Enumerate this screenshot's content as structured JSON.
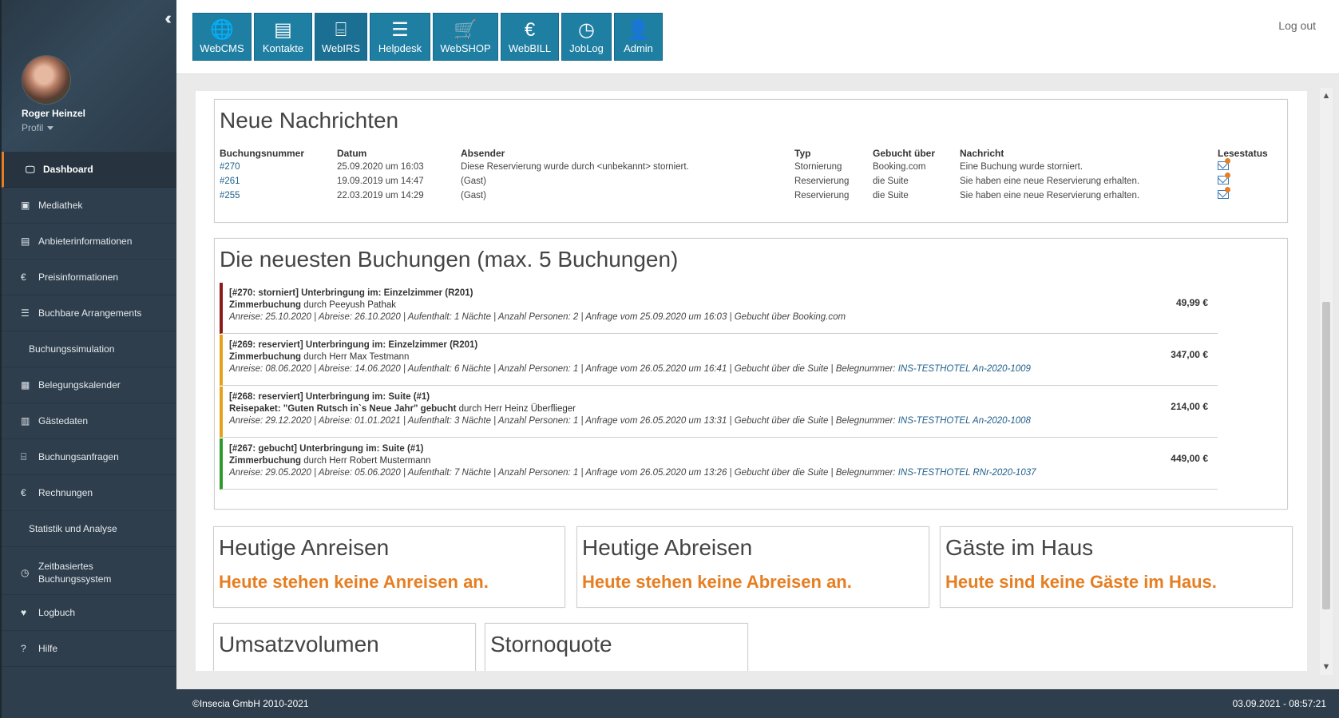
{
  "sidebar": {
    "user_name": "Roger Heinzel",
    "profile_label": "Profil",
    "items": [
      {
        "label": "Dashboard",
        "icon": "monitor-icon",
        "glyph": "🖵",
        "active": true
      },
      {
        "label": "Mediathek",
        "icon": "image-icon",
        "glyph": "▣"
      },
      {
        "label": "Anbieterinformationen",
        "icon": "id-card-icon",
        "glyph": "▤"
      },
      {
        "label": "Preisinformationen",
        "icon": "euro-icon",
        "glyph": "€"
      },
      {
        "label": "Buchbare Arrangements",
        "icon": "list-icon",
        "glyph": "☰"
      },
      {
        "label": "Buchungssimulation",
        "icon": "",
        "glyph": ""
      },
      {
        "label": "Belegungskalender",
        "icon": "calendar-icon",
        "glyph": "▦"
      },
      {
        "label": "Gästedaten",
        "icon": "address-book-icon",
        "glyph": "▥"
      },
      {
        "label": "Buchungsanfragen",
        "icon": "bed-icon",
        "glyph": "⌸"
      },
      {
        "label": "Rechnungen",
        "icon": "euro-icon",
        "glyph": "€"
      },
      {
        "label": "Statistik und Analyse",
        "icon": "",
        "glyph": ""
      },
      {
        "label": "Zeitbasiertes Buchungssystem",
        "icon": "clock-icon",
        "glyph": "◷"
      },
      {
        "label": "Logbuch",
        "icon": "heartbeat-icon",
        "glyph": "♥"
      },
      {
        "label": "Hilfe",
        "icon": "question-icon",
        "glyph": "?"
      }
    ]
  },
  "header": {
    "apps": [
      {
        "label": "WebCMS",
        "icon": "globe-icon",
        "glyph": "🌐"
      },
      {
        "label": "Kontakte",
        "icon": "contact-card-icon",
        "glyph": "▤"
      },
      {
        "label": "WebIRS",
        "icon": "bed-icon",
        "glyph": "⌸",
        "active": true
      },
      {
        "label": "Helpdesk",
        "icon": "list-icon",
        "glyph": "☰"
      },
      {
        "label": "WebSHOP",
        "icon": "cart-icon",
        "glyph": "🛒"
      },
      {
        "label": "WebBILL",
        "icon": "euro-icon",
        "glyph": "€"
      },
      {
        "label": "JobLog",
        "icon": "clock-icon",
        "glyph": "◷"
      },
      {
        "label": "Admin",
        "icon": "user-icon",
        "glyph": "👤"
      }
    ],
    "logout_label": "Log out"
  },
  "messages": {
    "title": "Neue Nachrichten",
    "columns": [
      "Buchungsnummer",
      "Datum",
      "Absender",
      "Typ",
      "Gebucht über",
      "Nachricht",
      "Lesestatus"
    ],
    "rows": [
      {
        "number": "#270",
        "date": "25.09.2020 um 16:03",
        "sender": "Diese Reservierung wurde durch <unbekannt> storniert.",
        "type": "Stornierung",
        "via": "Booking.com",
        "message": "Eine Buchung wurde storniert."
      },
      {
        "number": "#261",
        "date": "19.09.2019 um 14:47",
        "sender": "(Gast)",
        "type": "Reservierung",
        "via": "die Suite",
        "message": "Sie haben eine neue Reservierung erhalten."
      },
      {
        "number": "#255",
        "date": "22.03.2019 um 14:29",
        "sender": "(Gast)",
        "type": "Reservierung",
        "via": "die Suite",
        "message": "Sie haben eine neue Reservierung erhalten."
      }
    ]
  },
  "bookings": {
    "title": "Die neuesten Buchungen (max. 5 Buchungen)",
    "items": [
      {
        "status_color": "#8b1a1a",
        "title": "[#270: storniert] Unterbringung im: Einzelzimmer (R201)",
        "type": "Zimmerbuchung",
        "by": " durch Peeyush Pathak",
        "meta": "Anreise: 25.10.2020 | Abreise: 26.10.2020 | Aufenthalt: 1 Nächte | Anzahl Personen: 2  | Anfrage vom 25.09.2020 um 16:03 | Gebucht über Booking.com",
        "doc": "",
        "price": "49,99 €"
      },
      {
        "status_color": "#e6a11a",
        "title": "[#269: reserviert] Unterbringung im: Einzelzimmer (R201)",
        "type": "Zimmerbuchung",
        "by": " durch Herr Max Testmann",
        "meta": "Anreise: 08.06.2020 | Abreise: 14.06.2020 | Aufenthalt: 6 Nächte | Anzahl Personen: 1  | Anfrage vom 26.05.2020 um 16:41 | Gebucht über die Suite | Belegnummer: ",
        "doc": "INS-TESTHOTEL An-2020-1009",
        "price": "347,00 €"
      },
      {
        "status_color": "#e6a11a",
        "title": "[#268: reserviert] Unterbringung im: Suite (#1)",
        "type": "Reisepaket: \"Guten Rutsch in`s Neue Jahr\" gebucht",
        "by": " durch Herr Heinz Überflieger",
        "meta": "Anreise: 29.12.2020 | Abreise: 01.01.2021 | Aufenthalt: 3 Nächte | Anzahl Personen: 1  | Anfrage vom 26.05.2020 um 13:31 | Gebucht über die Suite | Belegnummer: ",
        "doc": "INS-TESTHOTEL An-2020-1008",
        "price": "214,00 €"
      },
      {
        "status_color": "#2e9a2e",
        "title": "[#267: gebucht] Unterbringung im: Suite (#1)",
        "type": "Zimmerbuchung",
        "by": " durch Herr Robert Mustermann",
        "meta": "Anreise: 29.05.2020 | Abreise: 05.06.2020 | Aufenthalt: 7 Nächte | Anzahl Personen: 1  | Anfrage vom 26.05.2020 um 13:26 | Gebucht über die Suite | Belegnummer: ",
        "doc": "INS-TESTHOTEL RNr-2020-1037",
        "price": "449,00 €"
      }
    ]
  },
  "widgets": {
    "arrivals": {
      "title": "Heutige Anreisen",
      "message": "Heute stehen keine Anreisen an."
    },
    "departures": {
      "title": "Heutige Abreisen",
      "message": "Heute stehen keine Abreisen an."
    },
    "guests": {
      "title": "Gäste im Haus",
      "message": "Heute sind keine Gäste im Haus."
    },
    "revenue": {
      "title": "Umsatzvolumen"
    },
    "cancel_rate": {
      "title": "Stornoquote"
    }
  },
  "footer": {
    "copyright": "©Insecia GmbH 2010-2021",
    "datetime": "03.09.2021 - 08:57:21"
  },
  "colors": {
    "accent": "#e67e22",
    "sidebar": "#2f3e4c",
    "app_button": "#1f7fa3"
  }
}
